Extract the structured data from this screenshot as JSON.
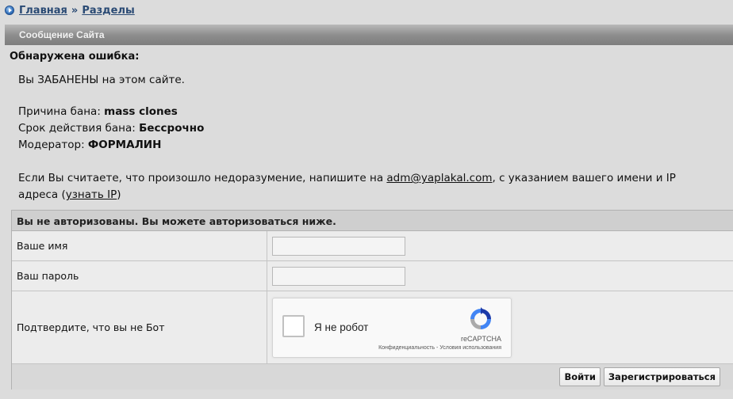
{
  "breadcrumb": {
    "icon": "play-circle-icon",
    "home": "Главная",
    "separator": "»",
    "section": "Разделы"
  },
  "header": {
    "title": "Сообщение Сайта"
  },
  "error": {
    "title": "Обнаружена ошибка:",
    "banned_message": "Вы ЗАБАНЕНЫ на этом сайте.",
    "reason_label": "Причина бана: ",
    "reason_value": "mass clones",
    "term_label": "Срок действия бана: ",
    "term_value": "Бессрочно",
    "moderator_label": "Модератор: ",
    "moderator_value": "ФОРМАЛИН",
    "contact_text_before": "Если Вы считаете, что произошло недоразумение, напишите на ",
    "contact_email": "adm@yaplakal.com",
    "contact_text_after": ", с указанием вашего имени и IP",
    "contact_line2_before": "адреса (",
    "ip_link": "узнать IP",
    "contact_line2_after": ")"
  },
  "auth": {
    "header": "Вы не авторизованы. Вы можете авторизоваться ниже.",
    "name_label": "Ваше имя",
    "name_value": "",
    "password_label": "Ваш пароль",
    "password_value": "",
    "captcha_label": "Подтвердите, что вы не Бот",
    "captcha": {
      "checkbox_label": "Я не робот",
      "brand": "reCAPTCHA",
      "links": "Конфиденциальность - Условия использования",
      "icon": "recaptcha-logo-icon"
    },
    "login_button": "Войти",
    "register_button": "Зарегистрироваться"
  },
  "colors": {
    "background": "#dcdcdc",
    "link": "#2a4a74",
    "header_bar": "#8e8e8e"
  }
}
